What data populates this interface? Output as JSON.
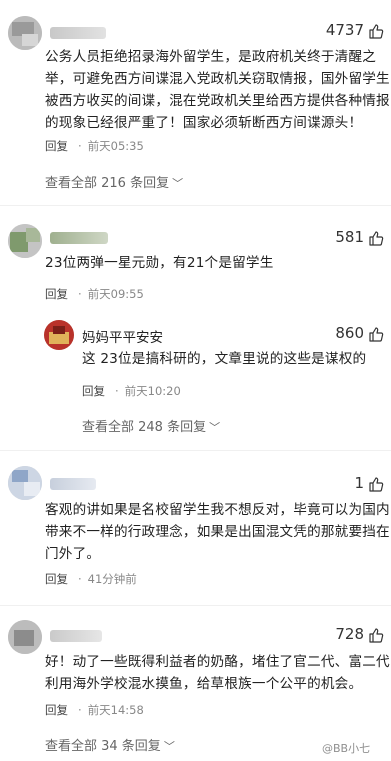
{
  "comments": [
    {
      "likes": "4737",
      "lines": [
        "公务人员拒绝招录海外留学生，是政府机关终于清醒之",
        "举，可避免西方间谍混入党政机关窃取情报，国外留学生",
        "被西方收买的间谍，混在党政机关里给西方提供各种情报",
        "的现象已经很严重了！国家必须斩断西方间谍源头！"
      ],
      "reply_label": "回复",
      "time": "前天05:35",
      "view_all": "查看全部 216 条回复"
    },
    {
      "likes": "581",
      "lines": [
        "23位两弹一星元勋，有21个是留学生"
      ],
      "reply_label": "回复",
      "time": "前天09:55"
    },
    {
      "likes": "1",
      "lines": [
        "客观的讲如果是名校留学生我不想反对，毕竟可以为国内",
        "带来不一样的行政理念，如果是出国混文凭的那就要挡在",
        "门外了。"
      ],
      "reply_label": "回复",
      "time": "41分钟前"
    },
    {
      "likes": "728",
      "lines": [
        "好！动了一些既得利益者的奶酪，堵住了官二代、富二代",
        "利用海外学校混水摸鱼，给草根族一个公平的机会。"
      ],
      "reply_label": "回复",
      "time": "前天14:58",
      "view_all": "查看全部 34 条回复"
    }
  ],
  "nested_reply": {
    "nickname": "妈妈平平安安",
    "likes": "860",
    "text": "这 23位是搞科研的，文章里说的这些是谋权的",
    "reply_label": "回复",
    "time": "前天10:20",
    "view_all": "查看全部 248 条回复"
  },
  "watermark": "@BB小七",
  "icons": {
    "like": "thumb-up-icon",
    "expand": "chevron-down-icon"
  }
}
